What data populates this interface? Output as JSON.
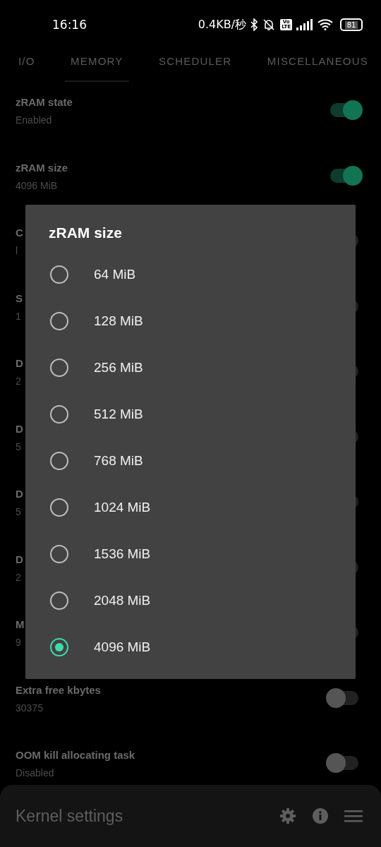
{
  "status_bar": {
    "time": "16:16",
    "speed": "0.4KB/秒",
    "volte": [
      "Vo",
      "LTE"
    ],
    "battery": "81"
  },
  "tabs": [
    {
      "label": "I/O",
      "selected": false
    },
    {
      "label": "MEMORY",
      "selected": true
    },
    {
      "label": "SCHEDULER",
      "selected": false
    },
    {
      "label": "MISCELLANEOUS",
      "selected": false
    }
  ],
  "settings": [
    {
      "title": "zRAM state",
      "value": "Enabled",
      "on": true
    },
    {
      "title": "zRAM size",
      "value": "4096 MiB",
      "on": true
    },
    {
      "title": "C",
      "value": "l",
      "on": false
    },
    {
      "title": "S",
      "value": "1",
      "on": false
    },
    {
      "title": "D",
      "value": "2",
      "on": false
    },
    {
      "title": "D",
      "value": "5",
      "on": false
    },
    {
      "title": "D",
      "value": "5",
      "on": false
    },
    {
      "title": "D",
      "value": "2",
      "on": false
    },
    {
      "title": "M",
      "value": "9",
      "on": false
    },
    {
      "title": "Extra free kbytes",
      "value": "30375",
      "on": false
    },
    {
      "title": "OOM kill allocating task",
      "value": "Disabled",
      "on": false
    }
  ],
  "dialog": {
    "title": "zRAM size",
    "options": [
      {
        "label": "64 MiB",
        "selected": false
      },
      {
        "label": "128 MiB",
        "selected": false
      },
      {
        "label": "256 MiB",
        "selected": false
      },
      {
        "label": "512 MiB",
        "selected": false
      },
      {
        "label": "768 MiB",
        "selected": false
      },
      {
        "label": "1024 MiB",
        "selected": false
      },
      {
        "label": "1536 MiB",
        "selected": false
      },
      {
        "label": "2048 MiB",
        "selected": false
      },
      {
        "label": "4096 MiB",
        "selected": true
      }
    ]
  },
  "bottom_bar": {
    "title": "Kernel settings"
  }
}
